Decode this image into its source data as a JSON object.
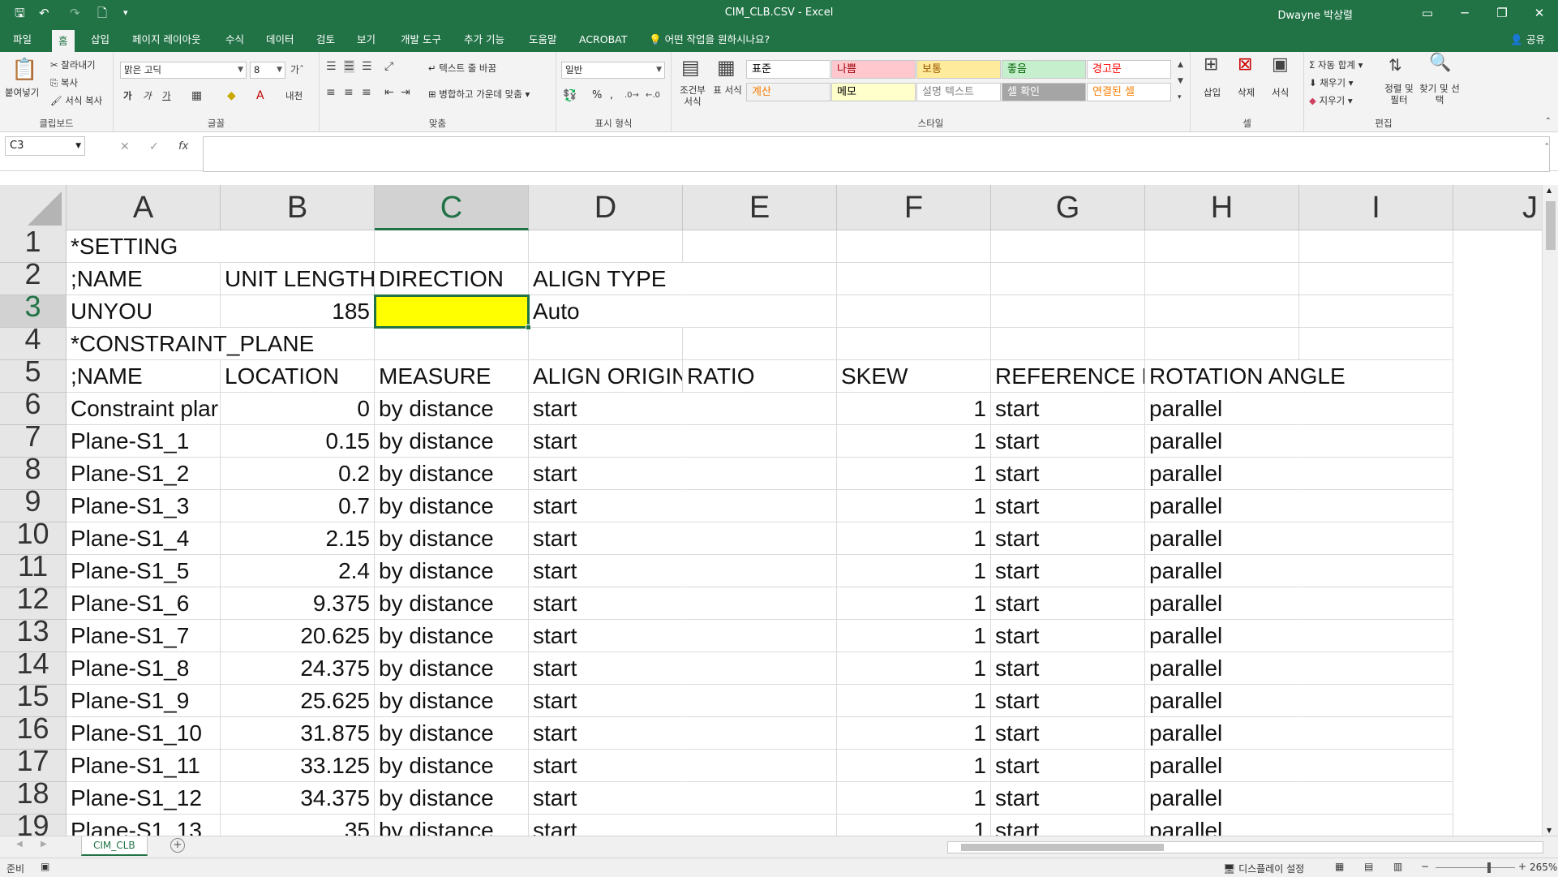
{
  "window": {
    "title": "CIM_CLB.CSV  -  Excel",
    "user": "Dwayne 박상렬",
    "minimize_glyph": "─",
    "restore_glyph": "❐",
    "close_glyph": "✕",
    "options_glyph": "▭"
  },
  "qat": {
    "save": "🖫",
    "undo": "↶",
    "redo": "↷",
    "preview": "🗋",
    "more": "▾"
  },
  "menu": {
    "tabs": [
      "파일",
      "홈",
      "삽입",
      "페이지 레이아웃",
      "수식",
      "데이터",
      "검토",
      "보기",
      "개발 도구",
      "추가 기능",
      "도움말",
      "ACROBAT",
      "어떤 작업을 원하시나요?"
    ],
    "active": "홈",
    "share": "공유"
  },
  "ribbon": {
    "clipboard": {
      "paste": "붙여넣기",
      "cut": "잘라내기",
      "copy": "복사",
      "format_painter": "서식 복사",
      "label": "클립보드"
    },
    "font": {
      "name": "맑은 고딕",
      "size": "8",
      "label": "글꼴",
      "bold": "가",
      "italic": "가",
      "underline": "가",
      "phonetic": "내천"
    },
    "alignment": {
      "wrap": "텍스트 줄 바꿈",
      "merge": "병합하고 가운데 맞춤",
      "label": "맞춤"
    },
    "number": {
      "format": "일반",
      "percent": "%",
      "comma": ",",
      "label": "표시 형식"
    },
    "styles": {
      "conditional": "조건부 서식",
      "table": "표 서식",
      "cells": [
        {
          "text": "표준",
          "bg": "#ffffff",
          "color": "#000000"
        },
        {
          "text": "나쁨",
          "bg": "#ffc7ce",
          "color": "#9c0006"
        },
        {
          "text": "보통",
          "bg": "#ffeb9c",
          "color": "#9c5700"
        },
        {
          "text": "좋음",
          "bg": "#c6efce",
          "color": "#006100"
        },
        {
          "text": "경고문",
          "bg": "#ffffff",
          "color": "#ff0000"
        },
        {
          "text": "계산",
          "bg": "#f2f2f2",
          "color": "#fa7d00"
        },
        {
          "text": "메모",
          "bg": "#ffffcc",
          "color": "#000000"
        },
        {
          "text": "설명 텍스트",
          "bg": "#ffffff",
          "color": "#7f7f7f"
        },
        {
          "text": "셀 확인",
          "bg": "#a5a5a5",
          "color": "#ffffff"
        },
        {
          "text": "연결된 셀",
          "bg": "#ffffff",
          "color": "#fa7d00"
        }
      ],
      "label": "스타일"
    },
    "cells_grp": {
      "insert": "삽입",
      "delete": "삭제",
      "format": "서식",
      "label": "셀"
    },
    "editing": {
      "autosum": "자동 합계",
      "fill": "채우기",
      "clear": "지우기",
      "sort": "정렬 및 필터",
      "find": "찾기 및 선택",
      "label": "편집"
    }
  },
  "formula_bar": {
    "name_box": "C3",
    "formula": "",
    "cancel": "✕",
    "enter": "✓",
    "fx": "fx"
  },
  "sheet": {
    "columns": [
      "A",
      "B",
      "C",
      "D",
      "E",
      "F",
      "G",
      "H",
      "I",
      "J"
    ],
    "selected_column": "C",
    "selected_row": "3",
    "rows": [
      {
        "n": "1",
        "cells": [
          "*SETTING",
          "",
          "",
          "",
          "",
          "",
          "",
          "",
          ""
        ]
      },
      {
        "n": "2",
        "cells": [
          ";NAME",
          "UNIT LENGTH",
          "DIRECTION",
          "ALIGN TYPE",
          "",
          "",
          "",
          "",
          ""
        ]
      },
      {
        "n": "3",
        "cells": [
          "UNYOU",
          "185",
          "",
          "Auto",
          "",
          "",
          "",
          "",
          ""
        ]
      },
      {
        "n": "4",
        "cells": [
          "*CONSTRAINT_PLANE",
          "",
          "",
          "",
          "",
          "",
          "",
          "",
          ""
        ]
      },
      {
        "n": "5",
        "cells": [
          ";NAME",
          "LOCATION",
          "MEASURE",
          "ALIGN ORIGIN",
          "RATIO",
          "SKEW",
          "REFERENCE PC",
          "ROTATION ANGLE",
          ""
        ]
      },
      {
        "n": "6",
        "cells": [
          "Constraint plar",
          "0",
          "by distance",
          "start",
          "",
          "1",
          "start",
          "parallel",
          ""
        ]
      },
      {
        "n": "7",
        "cells": [
          "Plane-S1_1",
          "0.15",
          "by distance",
          "start",
          "",
          "1",
          "start",
          "parallel",
          ""
        ]
      },
      {
        "n": "8",
        "cells": [
          "Plane-S1_2",
          "0.2",
          "by distance",
          "start",
          "",
          "1",
          "start",
          "parallel",
          ""
        ]
      },
      {
        "n": "9",
        "cells": [
          "Plane-S1_3",
          "0.7",
          "by distance",
          "start",
          "",
          "1",
          "start",
          "parallel",
          ""
        ]
      },
      {
        "n": "10",
        "cells": [
          "Plane-S1_4",
          "2.15",
          "by distance",
          "start",
          "",
          "1",
          "start",
          "parallel",
          ""
        ]
      },
      {
        "n": "11",
        "cells": [
          "Plane-S1_5",
          "2.4",
          "by distance",
          "start",
          "",
          "1",
          "start",
          "parallel",
          ""
        ]
      },
      {
        "n": "12",
        "cells": [
          "Plane-S1_6",
          "9.375",
          "by distance",
          "start",
          "",
          "1",
          "start",
          "parallel",
          ""
        ]
      },
      {
        "n": "13",
        "cells": [
          "Plane-S1_7",
          "20.625",
          "by distance",
          "start",
          "",
          "1",
          "start",
          "parallel",
          ""
        ]
      },
      {
        "n": "14",
        "cells": [
          "Plane-S1_8",
          "24.375",
          "by distance",
          "start",
          "",
          "1",
          "start",
          "parallel",
          ""
        ]
      },
      {
        "n": "15",
        "cells": [
          "Plane-S1_9",
          "25.625",
          "by distance",
          "start",
          "",
          "1",
          "start",
          "parallel",
          ""
        ]
      },
      {
        "n": "16",
        "cells": [
          "Plane-S1_10",
          "31.875",
          "by distance",
          "start",
          "",
          "1",
          "start",
          "parallel",
          ""
        ]
      },
      {
        "n": "17",
        "cells": [
          "Plane-S1_11",
          "33.125",
          "by distance",
          "start",
          "",
          "1",
          "start",
          "parallel",
          ""
        ]
      },
      {
        "n": "18",
        "cells": [
          "Plane-S1_12",
          "34.375",
          "by distance",
          "start",
          "",
          "1",
          "start",
          "parallel",
          ""
        ]
      },
      {
        "n": "19",
        "cells": [
          "Plane-S1_13",
          "35",
          "by distance",
          "start",
          "",
          "1",
          "start",
          "parallel",
          ""
        ]
      }
    ],
    "active_fill": "#ffff00"
  },
  "sheet_tabs": {
    "tabs": [
      "CIM_CLB"
    ],
    "add": "+"
  },
  "status": {
    "ready": "준비",
    "display_settings": "디스플레이 설정",
    "zoom": "265%",
    "zoom_minus": "−",
    "zoom_plus": "+"
  }
}
